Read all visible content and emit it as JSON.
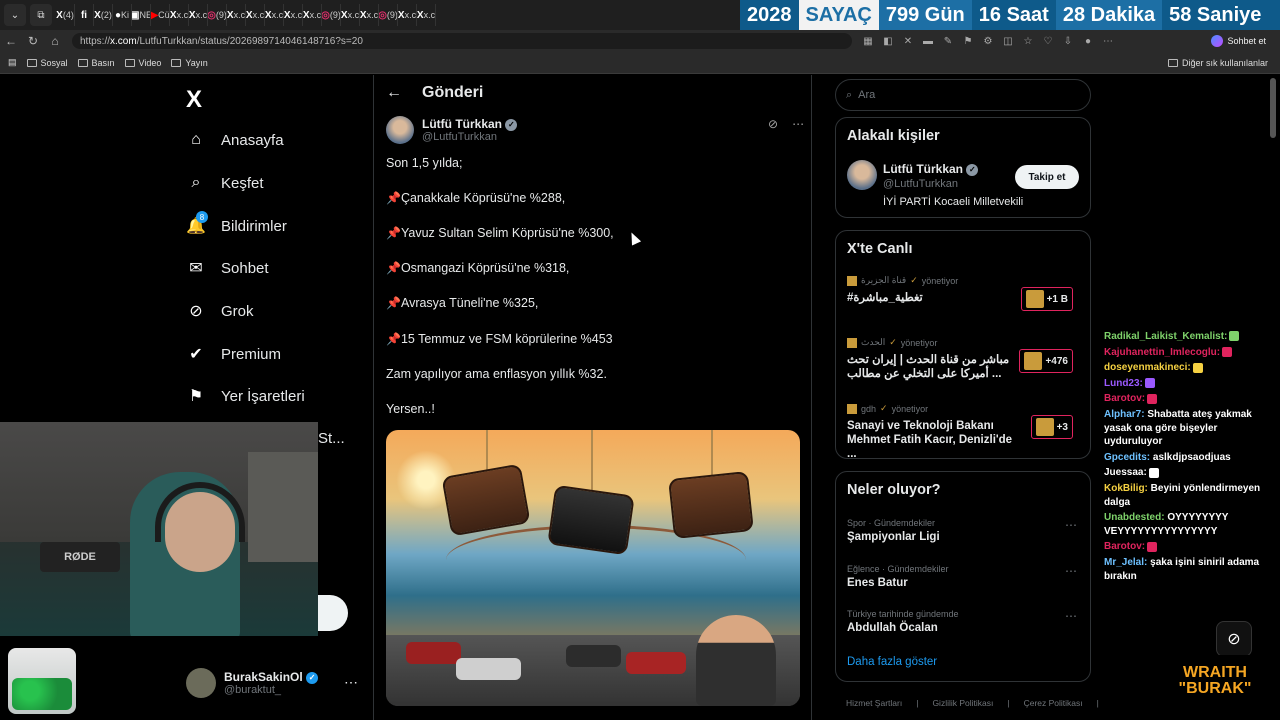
{
  "browser": {
    "tabs": [
      {
        "icon": "X",
        "label": "(4)"
      },
      {
        "icon": "fi",
        "label": ""
      },
      {
        "icon": "X",
        "label": "(2)"
      },
      {
        "icon": "●",
        "label": "Ki"
      },
      {
        "icon": "▣",
        "label": "NE"
      },
      {
        "icon": "▶",
        "label": "Cü"
      },
      {
        "icon": "X",
        "label": "x.c"
      },
      {
        "icon": "X",
        "label": "x.c"
      },
      {
        "icon": "◎",
        "label": "(9)"
      },
      {
        "icon": "X",
        "label": "x.c"
      },
      {
        "icon": "X",
        "label": "x.c"
      },
      {
        "icon": "X",
        "label": "x.c"
      },
      {
        "icon": "X",
        "label": "x.c"
      },
      {
        "icon": "X",
        "label": "x.c"
      },
      {
        "icon": "◎",
        "label": "(9)"
      },
      {
        "icon": "X",
        "label": "x.c"
      },
      {
        "icon": "X",
        "label": "x.c"
      },
      {
        "icon": "◎",
        "label": "(9)"
      },
      {
        "icon": "X",
        "label": "x.c"
      },
      {
        "icon": "X",
        "label": "x.c"
      }
    ],
    "url_prefix": "https://",
    "url_host": "x.com",
    "url_path": "/LutfuTurkkan/status/2026989714046148716?s=20",
    "chat_button": "Sohbet et",
    "bookmarks": [
      "Sosyal",
      "Basın",
      "Video",
      "Yayın"
    ],
    "other_bookmarks": "Diğer sık kullanılanlar"
  },
  "counter": {
    "year": "2028",
    "label": "SAYAÇ",
    "days": "799 Gün",
    "hours": "16 Saat",
    "minutes": "28 Dakika",
    "seconds": "58 Saniye"
  },
  "nav": {
    "logo": "X",
    "items": [
      {
        "label": "Anasayfa",
        "icon": "home-icon"
      },
      {
        "label": "Keşfet",
        "icon": "search-icon"
      },
      {
        "label": "Bildirimler",
        "icon": "bell-icon",
        "badge": "8"
      },
      {
        "label": "Sohbet",
        "icon": "mail-icon"
      },
      {
        "label": "Grok",
        "icon": "grok-icon"
      },
      {
        "label": "Premium",
        "icon": "premium-icon"
      },
      {
        "label": "Yer İşaretleri",
        "icon": "bookmark-icon"
      }
    ],
    "more_partial": "St...",
    "account_name": "BurakSakinOl",
    "account_handle": "@buraktut_"
  },
  "post": {
    "header_title": "Gönderi",
    "author_name": "Lütfü Türkkan",
    "author_handle": "@LutfuTurkkan",
    "lines": [
      {
        "pin": false,
        "text": "Son 1,5 yılda;"
      },
      {
        "pin": true,
        "text": "Çanakkale Köprüsü'ne %288,"
      },
      {
        "pin": true,
        "text": "Yavuz Sultan Selim Köprüsü'ne %300,"
      },
      {
        "pin": true,
        "text": "Osmangazi Köprüsü'ne %318,"
      },
      {
        "pin": true,
        "text": "Avrasya Tüneli'ne %325,"
      },
      {
        "pin": true,
        "text": "15 Temmuz ve FSM köprülerine %453"
      },
      {
        "pin": false,
        "text": "Zam yapılıyor ama enflasyon yıllık %32."
      },
      {
        "pin": false,
        "text": "Yersen..!"
      }
    ]
  },
  "right": {
    "search_placeholder": "Ara",
    "related_title": "Alakalı kişiler",
    "related_name": "Lütfü Türkkan",
    "related_handle": "@LutfuTurkkan",
    "related_bio": "İYİ PARTİ Kocaeli Milletvekili",
    "follow_label": "Takip et",
    "live_title": "X'te Canlı",
    "live": [
      {
        "host": "قناة الجزيرة",
        "role": "yönetiyor",
        "title": "#تغطية_مباشرة",
        "count": "+1 B"
      },
      {
        "host": "الحدث",
        "role": "yönetiyor",
        "title": "مباشر من قناة الحدث | إيران تحث أميركا على التخلي عن مطالب ...",
        "count": "+476"
      },
      {
        "host": "gdh",
        "role": "yönetiyor",
        "title": "Sanayi ve Teknoloji Bakanı Mehmet Fatih Kacır, Denizli'de ...",
        "count": "+3"
      }
    ],
    "trends_title": "Neler oluyor?",
    "trends": [
      {
        "category": "Spor · Gündemdekiler",
        "name": "Şampiyonlar Ligi"
      },
      {
        "category": "Eğlence · Gündemdekiler",
        "name": "Enes Batur"
      },
      {
        "category": "Türkiye tarihinde gündemde",
        "name": "Abdullah Öcalan"
      }
    ],
    "more_link": "Daha fazla göster",
    "footer": [
      "Hizmet Şartları",
      "|",
      "Gizlilik Politikası",
      "|",
      "Çerez Politikası",
      "|"
    ]
  },
  "chat": [
    {
      "user": "Radikal_Laikist_Kemalist:",
      "color": "#7fd36b",
      "msg": ""
    },
    {
      "user": "Kajuhanettin_Imlecoglu:",
      "color": "#e0245e",
      "msg": ""
    },
    {
      "user": "doseyenmakineci:",
      "color": "#f5d142",
      "msg": ""
    },
    {
      "user": "Lund23:",
      "color": "#9b59ff",
      "msg": ""
    },
    {
      "user": "Barotov:",
      "color": "#e0245e",
      "msg": ""
    },
    {
      "user": "Alphar7:",
      "color": "#6ec1ff",
      "msg": "Shabatta ateş yakmak yasak ona göre bişeyler uyduruluyor"
    },
    {
      "user": "Gpcedits:",
      "color": "#6ec1ff",
      "msg": "aslkdjpsaodjuas"
    },
    {
      "user": "Juessaa:",
      "color": "#ffffff",
      "msg": ""
    },
    {
      "user": "KokBilig:",
      "color": "#f5d142",
      "msg": "Beyini yönlendirmeyen dalga"
    },
    {
      "user": "Unabdested:",
      "color": "#7fd36b",
      "msg": "OYYYYYYYY VEYYYYYYYYYYYYYYY"
    },
    {
      "user": "Barotov:",
      "color": "#e0245e",
      "msg": ""
    },
    {
      "user": "Mr_Jelal:",
      "color": "#6ec1ff",
      "msg": "şaka işini siniril adama bırakın"
    }
  ],
  "brand_line1": "WRAITH",
  "brand_line2": "\"BURAK\""
}
